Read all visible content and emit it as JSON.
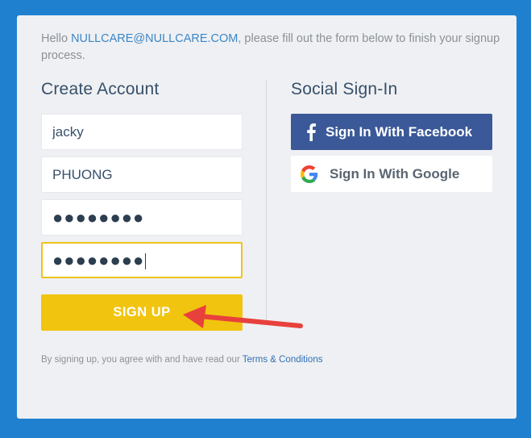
{
  "intro": {
    "prefix": "Hello ",
    "email": "NULLCARE@NULLCARE.COM",
    "suffix": ", please fill out the form below to finish your signup process."
  },
  "create_account": {
    "title": "Create Account",
    "first_name_value": "jacky",
    "last_name_value": "PHUONG",
    "password_value": "●●●●●●●●",
    "confirm_password_value": "●●●●●●●●",
    "signup_label": "SIGN UP"
  },
  "social": {
    "title": "Social Sign-In",
    "facebook_label": "Sign In With Facebook",
    "google_label": "Sign In With Google"
  },
  "terms": {
    "text": "By signing up, you agree with and have read our ",
    "link": "Terms & Conditions"
  },
  "colors": {
    "background": "#1f80cf",
    "panel": "#eff0f3",
    "signup_button": "#f1c40f",
    "facebook_button": "#3b5998",
    "annotation_arrow": "#e8413c"
  }
}
